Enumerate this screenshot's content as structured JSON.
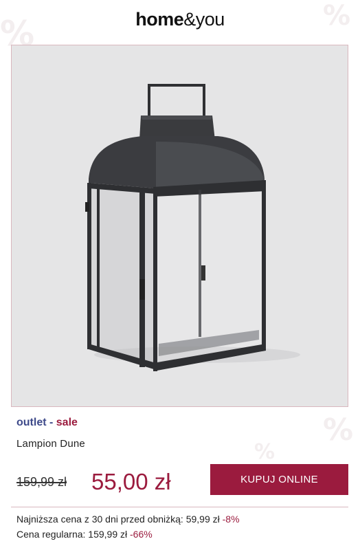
{
  "header": {
    "logo_part1": "home",
    "logo_part2": "&you"
  },
  "product": {
    "image_alt": "Lampion Dune",
    "category_part1": "outlet",
    "category_separator": " - ",
    "category_part2": "sale",
    "name": "Lampion Dune"
  },
  "pricing": {
    "old_price": "159,99 zł",
    "new_price": "55,00 zł",
    "buy_label": "KUPUJ ONLINE"
  },
  "info": {
    "lowest_label": "Najniższa cena z 30 dni przed obniżką: 59,99 zł ",
    "lowest_discount": "-8%",
    "regular_label": "Cena regularna: 159,99 zł ",
    "regular_discount": "-66%"
  },
  "colors": {
    "accent": "#9b1b3e",
    "category_blue": "#3e4a8a",
    "image_bg": "#e5e5e6"
  }
}
